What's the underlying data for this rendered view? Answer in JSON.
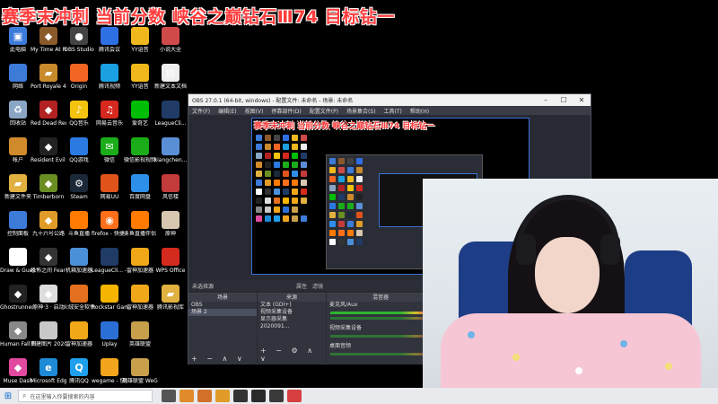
{
  "banner": {
    "text": "赛季末冲刺 当前分数 峡谷之巅钻石Ⅲ74 目标钻一"
  },
  "desktop_icons": [
    {
      "label": "此电脑",
      "icon": "computer-icon",
      "color": "#3d7bd9"
    },
    {
      "label": "My Time At Portia",
      "icon": "game-icon",
      "color": "#8b5a2b"
    },
    {
      "label": "OBS Studio",
      "icon": "obs-icon",
      "color": "#444"
    },
    {
      "label": "腾讯会议",
      "icon": "meeting-icon",
      "color": "#2f6fe4"
    },
    {
      "label": "YY语音",
      "icon": "yy-icon",
      "color": "#f0b81c"
    },
    {
      "label": "小说大全",
      "icon": "book-icon",
      "color": "#d04a4a"
    },
    {
      "label": "网络",
      "icon": "network-icon",
      "color": "#3d7bd9"
    },
    {
      "label": "Port Royale 4 Soundtr...",
      "icon": "folder-icon",
      "color": "#c98a2c"
    },
    {
      "label": "Origin",
      "icon": "origin-icon",
      "color": "#f26522"
    },
    {
      "label": "腾讯视频",
      "icon": "video-icon",
      "color": "#1ba0e2"
    },
    {
      "label": "YY语音",
      "icon": "yy-icon",
      "color": "#f0b81c"
    },
    {
      "label": "新建文本文档",
      "icon": "text-file-icon",
      "color": "#eeeeee"
    },
    {
      "label": "回收站",
      "icon": "recycle-bin-icon",
      "color": "#8aa6c4"
    },
    {
      "label": "Red Dead Redempti...",
      "icon": "game-icon",
      "color": "#b22222"
    },
    {
      "label": "QQ音乐",
      "icon": "music-icon",
      "color": "#f2c40f"
    },
    {
      "label": "网易云音乐",
      "icon": "netease-music-icon",
      "color": "#d6281d"
    },
    {
      "label": "爱奇艺",
      "icon": "iqiyi-icon",
      "color": "#00be06"
    },
    {
      "label": "LeagueCli...",
      "icon": "league-icon",
      "color": "#1f3b66"
    },
    {
      "label": "帐户",
      "icon": "account-icon",
      "color": "#d08a2c"
    },
    {
      "label": "Resident Evil Village",
      "icon": "game-icon",
      "color": "#222"
    },
    {
      "label": "QQ游戏",
      "icon": "qq-game-icon",
      "color": "#2a7ae2"
    },
    {
      "label": "微信",
      "icon": "wechat-icon",
      "color": "#1aad19"
    },
    {
      "label": "微信影视视频",
      "icon": "wechat-video-icon",
      "color": "#1aad19"
    },
    {
      "label": "xiangchen...",
      "icon": "app-icon",
      "color": "#5a8fd6"
    },
    {
      "label": "新建文件夹",
      "icon": "folder-icon",
      "color": "#e0b040"
    },
    {
      "label": "Timberborn",
      "icon": "game-icon",
      "color": "#6b8e23"
    },
    {
      "label": "Steam",
      "icon": "steam-icon",
      "color": "#1b2838"
    },
    {
      "label": "网易UU",
      "icon": "uu-icon",
      "color": "#e0531a"
    },
    {
      "label": "百度网盘",
      "icon": "baidu-pan-icon",
      "color": "#2e8fe8"
    },
    {
      "label": "风信楼",
      "icon": "app-icon",
      "color": "#c43b3b"
    },
    {
      "label": "控制面板",
      "icon": "control-panel-icon",
      "color": "#3d7bd9"
    },
    {
      "label": "九十六号公路",
      "icon": "game-icon",
      "color": "#e09b28"
    },
    {
      "label": "斗鱼直播",
      "icon": "douyu-icon",
      "color": "#ff7a00"
    },
    {
      "label": "firefox - 快捷方式",
      "icon": "firefox-icon",
      "color": "#ff6f1a"
    },
    {
      "label": "斗鱼直播伴侣",
      "icon": "douyu-icon",
      "color": "#ff7a00"
    },
    {
      "label": "原神",
      "icon": "genshin-icon",
      "color": "#d7c7b0"
    },
    {
      "label": "Draw & Guess",
      "icon": "draw-guess-icon",
      "color": "#ffffff"
    },
    {
      "label": "恐怖之间 Fear surr...",
      "icon": "game-icon",
      "color": "#333"
    },
    {
      "label": "机箱加速器",
      "icon": "accelerator-icon",
      "color": "#4a90d9"
    },
    {
      "label": "LeagueCli... - 快捷方式",
      "icon": "league-icon",
      "color": "#1f3b66"
    },
    {
      "label": "雷神加速器",
      "icon": "leishen-icon",
      "color": "#f0a818"
    },
    {
      "label": "WPS Office",
      "icon": "wps-icon",
      "color": "#d52b1e"
    },
    {
      "label": "Ghostrunner - 快捷方式",
      "icon": "game-icon",
      "color": "#222"
    },
    {
      "label": "原神·3 · 启动",
      "icon": "game-icon",
      "color": "#ddd"
    },
    {
      "label": "火绒安全软件",
      "icon": "huorong-icon",
      "color": "#e2701e"
    },
    {
      "label": "Rockstar Games...",
      "icon": "rockstar-icon",
      "color": "#f4b400"
    },
    {
      "label": "雷神加速器",
      "icon": "leishen-icon",
      "color": "#f0a818"
    },
    {
      "label": "腾讯影视库",
      "icon": "folder-icon",
      "color": "#e0b040"
    },
    {
      "label": "Human Fall Flat",
      "icon": "game-icon",
      "color": "#888"
    },
    {
      "label": "新建图片 20200913...",
      "icon": "image-icon",
      "color": "#c8c8c8"
    },
    {
      "label": "雷神加速器",
      "icon": "leishen-icon",
      "color": "#f0a818"
    },
    {
      "label": "Uplay",
      "icon": "uplay-icon",
      "color": "#2b6fd6"
    },
    {
      "label": "英雄联盟",
      "icon": "lol-icon",
      "color": "#c8a04c"
    },
    {
      "label": "",
      "icon": "blank-icon",
      "color": "#000"
    },
    {
      "label": "Muse Dash",
      "icon": "game-icon",
      "color": "#e24aa0"
    },
    {
      "label": "Microsoft Edge",
      "icon": "edge-icon",
      "color": "#1f8ad6"
    },
    {
      "label": "腾讯QQ",
      "icon": "qq-icon",
      "color": "#1ea0ec"
    },
    {
      "label": "wegame - 快捷方式",
      "icon": "wegame-icon",
      "color": "#f2a51c"
    },
    {
      "label": "英雄联盟 WeGame版",
      "icon": "lol-icon",
      "color": "#c8a04c"
    }
  ],
  "obs": {
    "title": "OBS 27.0.1 (64-bit, windows) - 配置文件: 未命名 - 场景: 未命名",
    "menu": [
      "文件(F)",
      "编辑(E)",
      "视图(V)",
      "停靠部件(D)",
      "配置文件(P)",
      "场景集合(S)",
      "工具(T)",
      "帮助(H)"
    ],
    "preview_banner": "赛季末冲刺 当前分数 峡谷之巅钻石Ⅲ74 目标钻一",
    "status_left": "未选择源",
    "status_props": "属性",
    "status_filters": "滤镜",
    "scenes_header": "场景",
    "scenes": [
      "OBS",
      "场景 2"
    ],
    "sources_header": "来源",
    "sources": [
      "文本 (GDI+)",
      "视频采集设备",
      "显示器采集"
    ],
    "sources_extra": "2020091...",
    "mixer_header": "混音器",
    "mixer": [
      "麦克风/Aux",
      "视频采集设备",
      "桌面音频"
    ],
    "dock_buttons": "+ − ∧ ∨",
    "sources_buttons": "+ − ⚙ ∧ ∨"
  },
  "taskbar": {
    "search_placeholder": "在这里输入你要搜索的内容",
    "apps": [
      {
        "icon": "task-view-icon",
        "color": "#555"
      },
      {
        "icon": "app-icon",
        "color": "#e08a2c"
      },
      {
        "icon": "app-icon",
        "color": "#d2702a"
      },
      {
        "icon": "app-icon",
        "color": "#e09b28"
      },
      {
        "icon": "obs-icon",
        "color": "#333"
      },
      {
        "icon": "app-icon",
        "color": "#2a2a2a"
      },
      {
        "icon": "app-icon",
        "color": "#3a3a3a"
      },
      {
        "icon": "app-icon",
        "color": "#d64040"
      }
    ]
  }
}
